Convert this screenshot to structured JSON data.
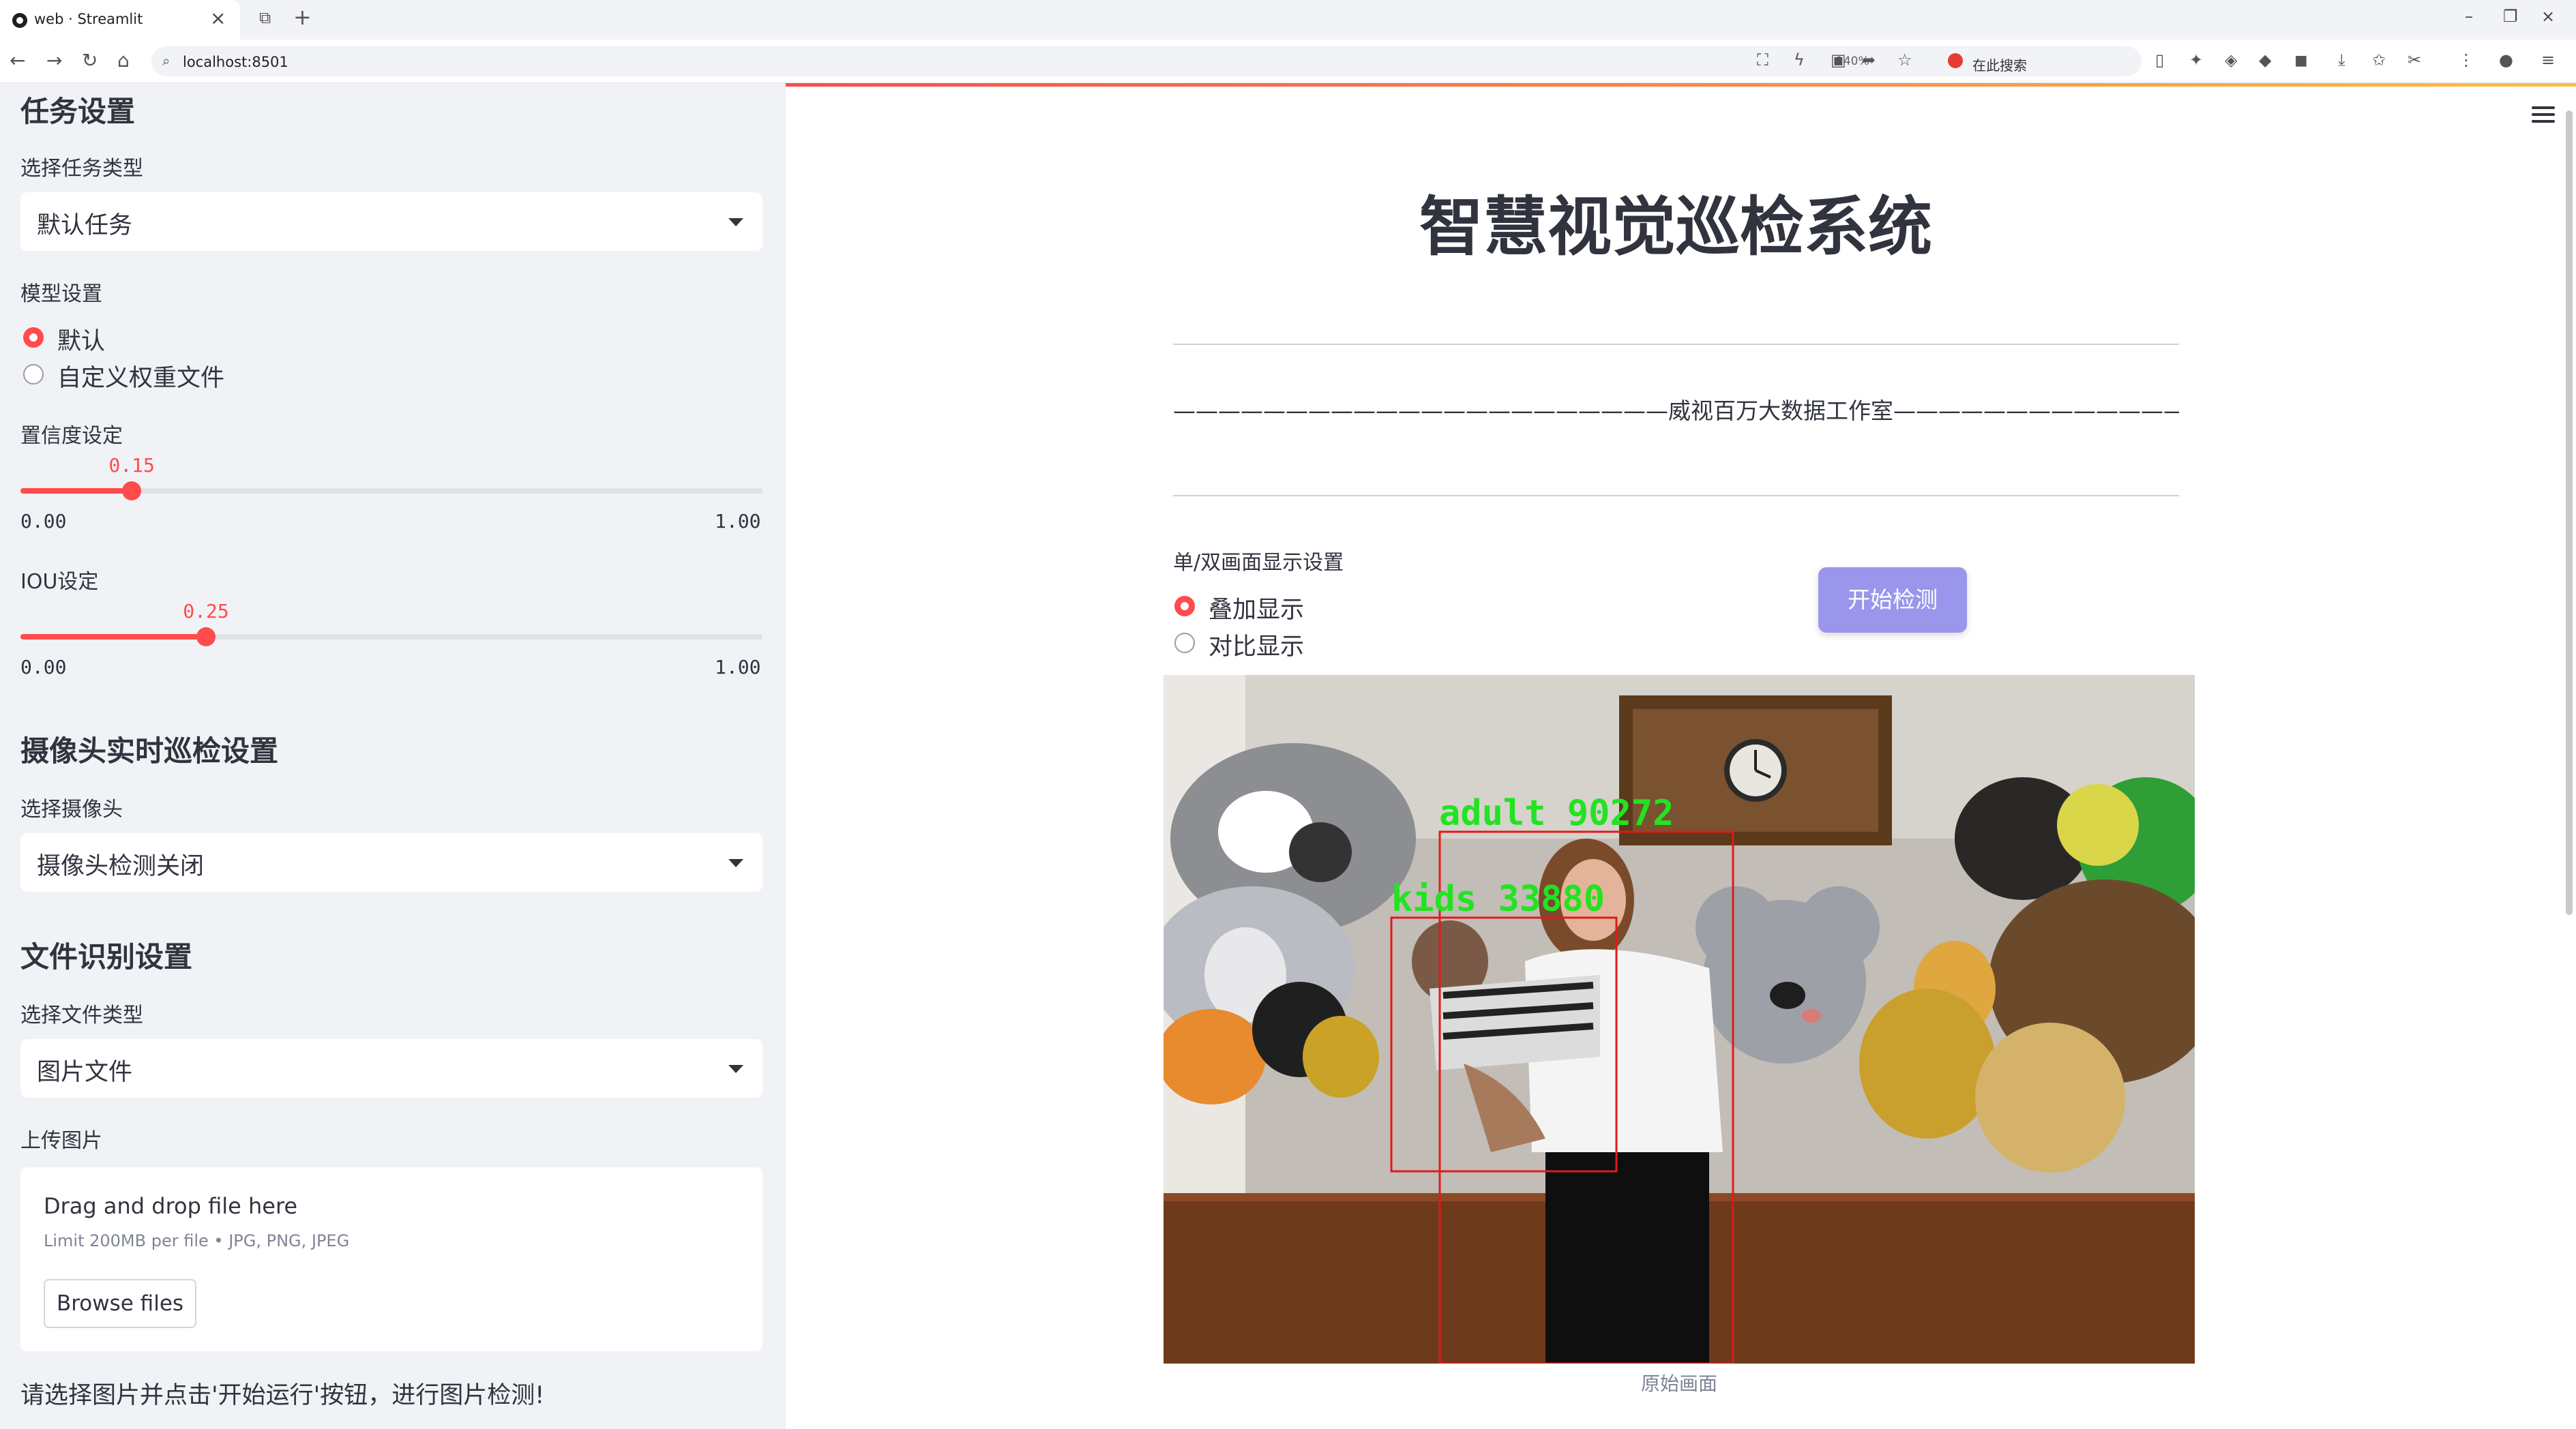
{
  "browser": {
    "tab_title": "web · Streamlit",
    "url": "localhost:8501",
    "zoom": "140%",
    "search_placeholder": "在此搜索"
  },
  "sidebar": {
    "task_section": {
      "heading": "任务设置",
      "label": "选择任务类型",
      "value": "默认任务"
    },
    "model_section": {
      "label": "模型设置",
      "options": [
        {
          "label": "默认",
          "selected": true
        },
        {
          "label": "自定义权重文件",
          "selected": false
        }
      ]
    },
    "confidence": {
      "label": "置信度设定",
      "value": "0.15",
      "fraction": 0.15,
      "min": "0.00",
      "max": "1.00"
    },
    "iou": {
      "label": "IOU设定",
      "value": "0.25",
      "fraction": 0.25,
      "min": "0.00",
      "max": "1.00"
    },
    "camera_section": {
      "heading": "摄像头实时巡检设置",
      "label": "选择摄像头",
      "value": "摄像头检测关闭"
    },
    "file_section": {
      "heading": "文件识别设置",
      "label": "选择文件类型",
      "value": "图片文件"
    },
    "upload": {
      "label": "上传图片",
      "drop_text": "Drag and drop file here",
      "limit_text": "Limit 200MB per file • JPG, PNG, JPEG",
      "browse_label": "Browse files"
    },
    "hint": "请选择图片并点击'开始运行'按钮，进行图片检测!"
  },
  "main": {
    "title": "智慧视觉巡检系统",
    "studio_line": "——————————————————————威视百万大数据工作室——————————————————————————————",
    "display_setting": {
      "label": "单/双画面显示设置",
      "options": [
        {
          "label": "叠加显示",
          "selected": true
        },
        {
          "label": "对比显示",
          "selected": false
        }
      ]
    },
    "start_button": "开始检测",
    "detections": [
      {
        "label": "adult  90272"
      },
      {
        "label": "kids  33880"
      }
    ],
    "caption": "原始画面"
  },
  "colors": {
    "accent": "#ff4b4b",
    "sidebar_bg": "#f0f2f6",
    "button_bg": "#9a96ec",
    "detection_text": "#22e322",
    "box_color": "#e01a1a"
  }
}
